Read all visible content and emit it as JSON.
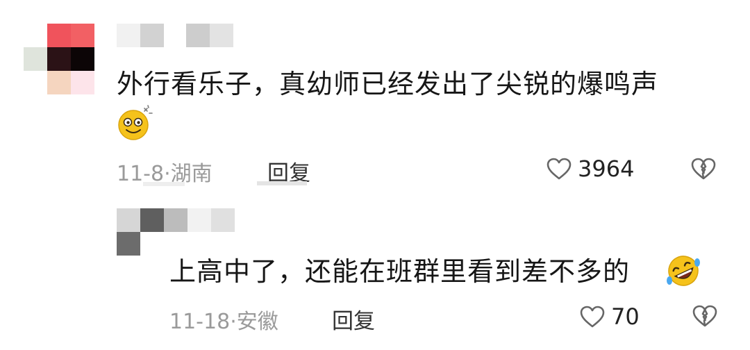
{
  "comments": [
    {
      "text": "外行看乐子，真幼师已经发出了尖锐的爆鸣声",
      "emoji": "dizzy-face-emoji",
      "date": "11-8",
      "separator": "·",
      "location": "湖南",
      "reply_label": "回复",
      "likes": "3964"
    },
    {
      "text": "上高中了，还能在班群里看到差不多的",
      "emoji": "rolling-laughing-emoji",
      "date": "11-18",
      "separator": "·",
      "location": "安徽",
      "reply_label": "回复",
      "likes": "70"
    }
  ],
  "icons": {
    "like": "heart-outline-icon",
    "dislike": "broken-heart-icon"
  },
  "colors": {
    "text": "#161616",
    "meta": "#9a9a9a",
    "icon": "#666666",
    "emoji_face": "#f5c21b"
  }
}
